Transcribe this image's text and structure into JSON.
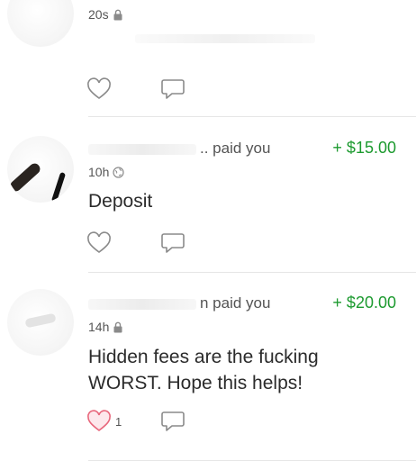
{
  "feed": {
    "stories": [
      {
        "time": "20s",
        "privacy_icon": "lock-icon",
        "actions": {
          "like_icon": "heart-icon",
          "comment_icon": "comment-icon"
        }
      },
      {
        "headline_visible": ".. paid you",
        "amount": "+ $15.00",
        "time": "10h",
        "privacy_icon": "globe-icon",
        "note": "Deposit",
        "actions": {
          "like_icon": "heart-icon",
          "comment_icon": "comment-icon"
        }
      },
      {
        "headline_visible": "n paid you",
        "amount": "+ $20.00",
        "time": "14h",
        "privacy_icon": "lock-icon",
        "note": "Hidden fees are the fucking WORST. Hope this helps!",
        "likes": "1",
        "liked": true,
        "actions": {
          "like_icon": "heart-icon",
          "comment_icon": "comment-icon"
        }
      }
    ]
  },
  "colors": {
    "amount_positive": "#1c9a2f",
    "liked_heart": "#e8677c"
  }
}
